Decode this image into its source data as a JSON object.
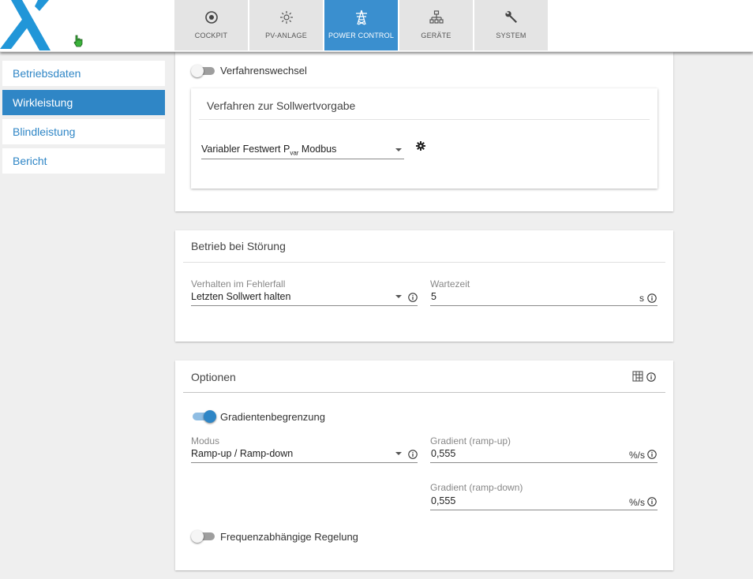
{
  "colors": {
    "accent": "#2f86c6",
    "tab_active": "#3a8fcf",
    "logo": "#2196d8"
  },
  "header": {
    "tabs": [
      {
        "label": "COCKPIT",
        "icon": "target-icon"
      },
      {
        "label": "PV-ANLAGE",
        "icon": "sun-icon"
      },
      {
        "label": "POWER CONTROL",
        "icon": "power-tower-icon",
        "active": true
      },
      {
        "label": "GERÄTE",
        "icon": "device-tree-icon"
      },
      {
        "label": "SYSTEM",
        "icon": "wrench-icon"
      }
    ]
  },
  "sidebar": {
    "items": [
      {
        "label": "Betriebsdaten"
      },
      {
        "label": "Wirkleistung",
        "active": true
      },
      {
        "label": "Blindleistung"
      },
      {
        "label": "Bericht"
      }
    ]
  },
  "procedure": {
    "change_label": "Verfahrenswechsel",
    "change_enabled": false,
    "section_title": "Verfahren zur Sollwertvorgabe",
    "select_value_main": "Variabler Festwert P",
    "select_value_sub": "var",
    "select_value_tail": " Modbus"
  },
  "fault": {
    "title": "Betrieb bei Störung",
    "behavior_label": "Verhalten im Fehlerfall",
    "behavior_value": "Letzten Sollwert halten",
    "wait_label": "Wartezeit",
    "wait_value": "5",
    "wait_unit": "s"
  },
  "options": {
    "title": "Optionen",
    "gradient_label": "Gradientenbegrenzung",
    "gradient_enabled": true,
    "mode_label": "Modus",
    "mode_value": "Ramp-up / Ramp-down",
    "ramp_up_label": "Gradient (ramp-up)",
    "ramp_up_value": "0,555",
    "ramp_up_unit": "%/s",
    "ramp_down_label": "Gradient (ramp-down)",
    "ramp_down_value": "0,555",
    "ramp_down_unit": "%/s",
    "frequency_label": "Frequenzabhängige Regelung",
    "frequency_enabled": false
  }
}
